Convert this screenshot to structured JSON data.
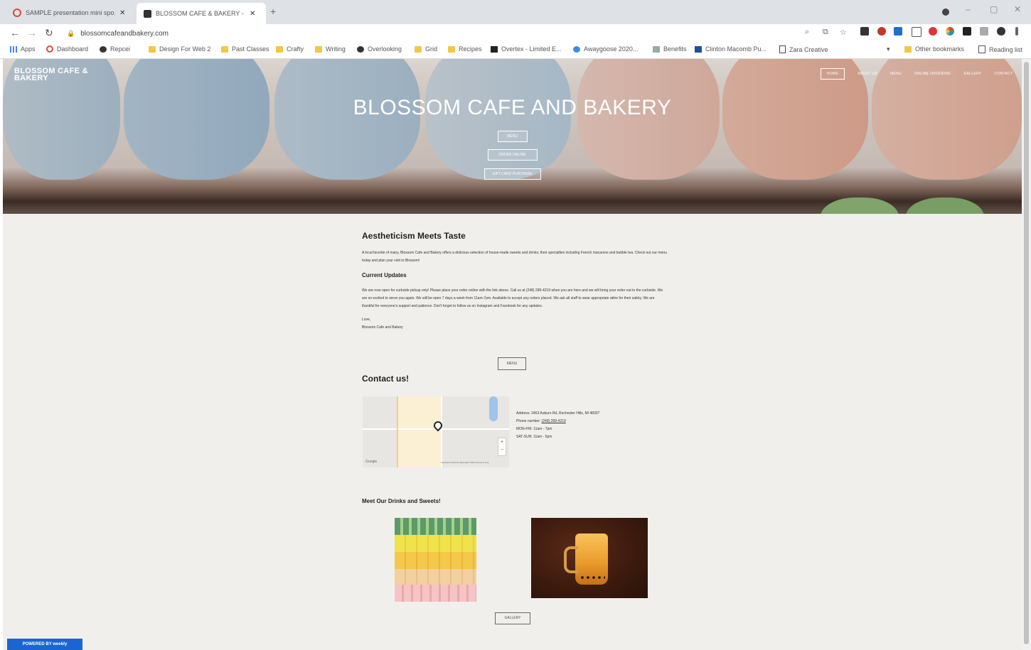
{
  "tabs": [
    {
      "title": "SAMPLE presentation mini spo...",
      "active": false
    },
    {
      "title": "BLOSSOM CAFE & BAKERY - Ho...",
      "active": true
    }
  ],
  "address_bar": {
    "url": "blossomcafeandbakery.com"
  },
  "bookmarks": [
    {
      "label": "Apps",
      "icon": "apps-grid-icon"
    },
    {
      "label": "Dashboard",
      "icon": "dashboard-icon"
    },
    {
      "label": "Repcei",
      "icon": "site-icon"
    },
    {
      "label": "Design For Web 2",
      "icon": "folder-icon"
    },
    {
      "label": "Past Classes",
      "icon": "folder-icon"
    },
    {
      "label": "Crafty",
      "icon": "folder-icon"
    },
    {
      "label": "Writing",
      "icon": "folder-icon"
    },
    {
      "label": "Overlooking",
      "icon": "site-icon"
    },
    {
      "label": "Grid",
      "icon": "folder-icon"
    },
    {
      "label": "Recipes",
      "icon": "folder-icon"
    },
    {
      "label": "Overtex - Limited E...",
      "icon": "site-icon"
    },
    {
      "label": "Awaygoose 2020...",
      "icon": "site-icon"
    },
    {
      "label": "Benefits",
      "icon": "site-icon"
    },
    {
      "label": "Clinton Macomb Pu...",
      "icon": "site-icon"
    },
    {
      "label": "Zara Creative",
      "icon": "site-icon"
    },
    {
      "label": "Other bookmarks",
      "icon": "folder-icon"
    },
    {
      "label": "Reading list",
      "icon": "reading-list-icon"
    }
  ],
  "site": {
    "logo": "BLOSSOM CAFE & BAKERY",
    "nav": [
      "HOME",
      "ABOUT US",
      "MENU",
      "ONLINE ORDERING",
      "GALLERY",
      "CONTACT"
    ],
    "hero_title": "BLOSSOM CAFE AND BAKERY",
    "hero_buttons": [
      "MENU",
      "ORDER ONLINE",
      "GIFT CARD PURCHASE"
    ]
  },
  "intro": {
    "heading": "Aestheticism Meets Taste",
    "body": "A local favorite of many, Blossom Cafe and Bakery offers a delicious selection of house-made sweets and drinks; their specialties including French macarons and bubble tea. Check out our menu today and plan your visit to Blossom!"
  },
  "updates": {
    "heading": "Current Updates",
    "body": "We are now open for curbside pickup only! Please place your order online with the link above. Call us at (248) 289-4219 when you are here and we will bring your order out to the curbside. We are so excited to serve you again. We will be open 7 days a week from 11am-7pm. Available to accept any orders placed. We ask all staff to wear appropriate attire for their safety. We are thankful for everyone's support and patience. Don't forget to follow us on Instagram and Facebook for any updates.",
    "signoff": [
      "Love,",
      "Blossom Cafe and Bakery"
    ],
    "button": "MENU"
  },
  "contact": {
    "heading": "Contact us!",
    "address": "Address: 2463 Auburn Rd, Rochester Hills, MI 48307",
    "phone_label": "Phone number:",
    "phone": "(248) 289-4219",
    "hours_1": "MON-FRI: 11am - 7pm",
    "hours_2": "SAT-SUN: 11am - 5pm",
    "map_credit": "Google",
    "map_footer": "Keyboard shortcuts   Map data ©2021   Terms of Use"
  },
  "gallery": {
    "heading": "Meet Our Drinks and Sweets!",
    "button": "GALLERY"
  },
  "badge": "POWERED BY weebly",
  "colors": {
    "page_bg": "#f1efeb",
    "badge_blue": "#1a65d3",
    "chrome_bg": "#dee1e6"
  }
}
